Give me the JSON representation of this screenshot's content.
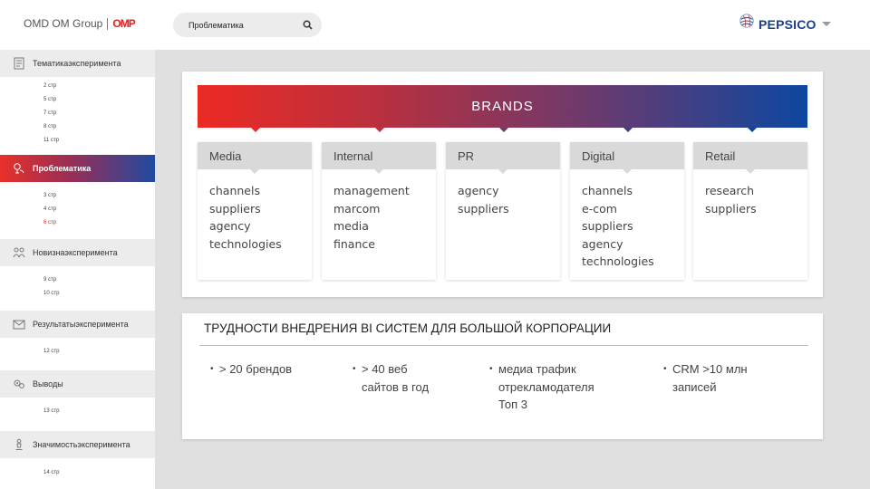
{
  "header": {
    "logo_text": "OMD OM Group",
    "logo_mark": "OMP",
    "search_value": "Проблематика",
    "brand_logo": "PEPSICO"
  },
  "sidebar": {
    "sections": [
      {
        "label": "Тематикаэксперимента",
        "icon": "document-icon",
        "pages": [
          "2 стр",
          "5 стр",
          "7 стр",
          "8 стр",
          "11 стр"
        ]
      },
      {
        "label": "Проблематика",
        "icon": "problem-icon",
        "active": true,
        "pages": [
          "3 стр",
          "4 стр",
          "6 стр"
        ],
        "current_page": "6 стр"
      },
      {
        "label": "Новизнаэксперимента",
        "icon": "people-icon",
        "pages": [
          "9 стр",
          "10 стр"
        ]
      },
      {
        "label": "Результатыэксперимента",
        "icon": "envelope-chart-icon",
        "pages": [
          "12 стр"
        ]
      },
      {
        "label": "Выводы",
        "icon": "gears-icon",
        "pages": [
          "13 стр"
        ]
      },
      {
        "label": "Значимостьэксперимента",
        "icon": "chess-piece-icon",
        "pages": [
          "14 стр"
        ]
      }
    ]
  },
  "brands": {
    "title": "BRANDS",
    "columns": [
      {
        "head": "Media",
        "items": [
          "channels",
          "suppliers",
          "agency",
          "technologies"
        ]
      },
      {
        "head": "Internal",
        "items": [
          "management",
          "marcom",
          "media",
          "finance"
        ]
      },
      {
        "head": "PR",
        "items": [
          "agency",
          "suppliers"
        ]
      },
      {
        "head": "Digital",
        "items": [
          "channels",
          "e-com",
          "suppliers",
          "agency",
          "technologies"
        ]
      },
      {
        "head": "Retail",
        "items": [
          "research",
          "suppliers"
        ]
      }
    ]
  },
  "difficulties": {
    "title": "ТРУДНОСТИ ВНЕДРЕНИЯ BI СИСТЕМ ДЛЯ БОЛЬШОЙ КОРПОРАЦИИ",
    "bullets": [
      {
        "lines": [
          "> 20 брендов"
        ]
      },
      {
        "lines": [
          "> 40 веб",
          "сайтов в год"
        ]
      },
      {
        "lines": [
          "медиа трафик",
          "отрекламодателя",
          "Топ 3"
        ]
      },
      {
        "lines": [
          "CRM >10 млн",
          "записей"
        ]
      }
    ]
  },
  "colors": {
    "accent_red": "#e8302a",
    "accent_blue": "#1f4aa0",
    "pepsico_blue": "#1a3f8f"
  }
}
